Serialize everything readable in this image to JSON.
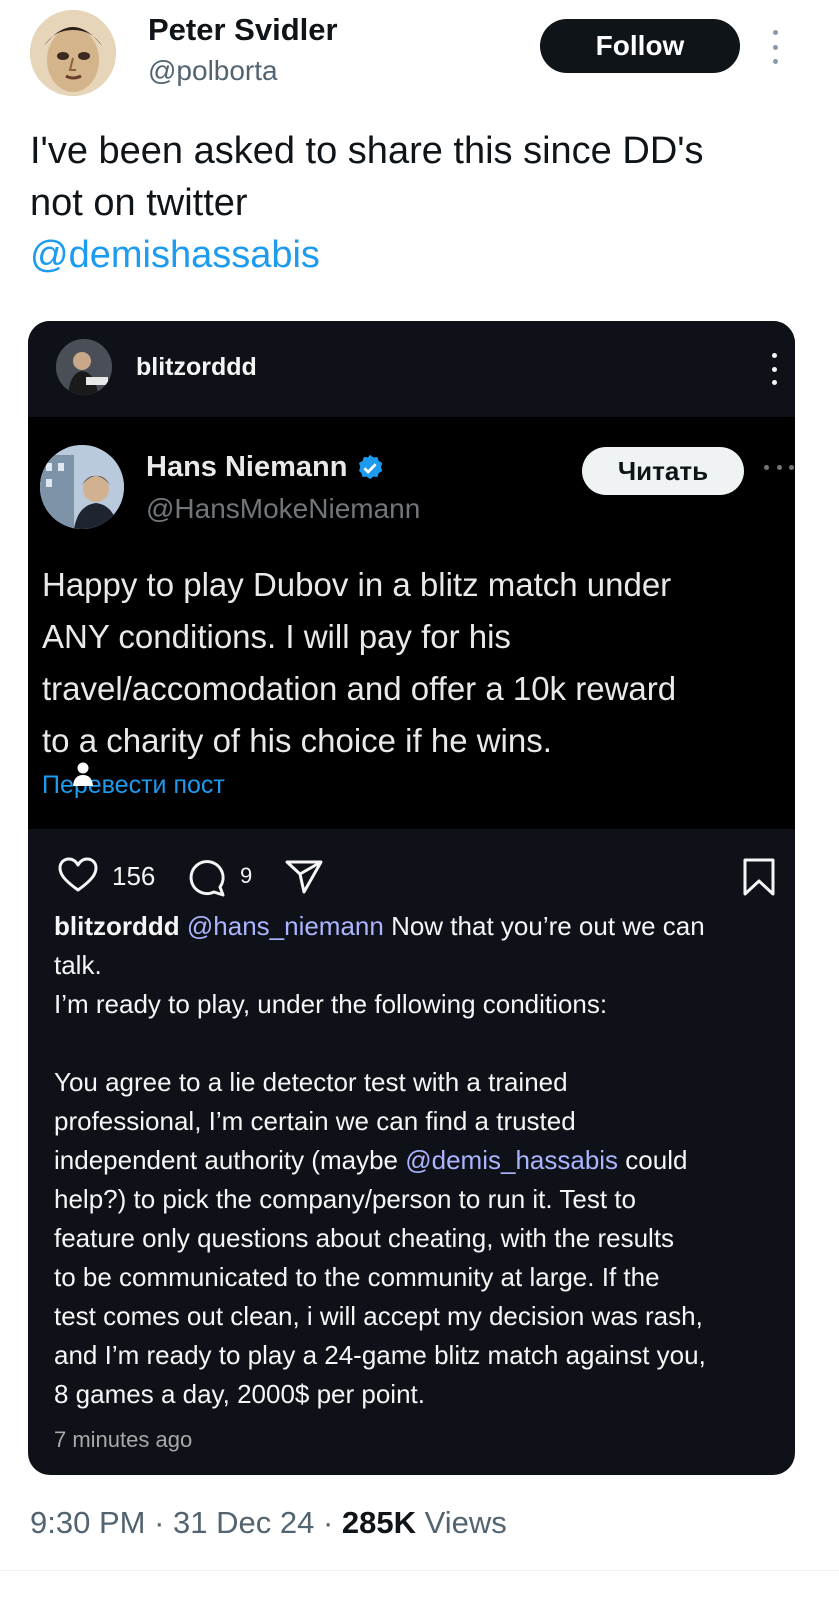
{
  "tweet": {
    "author_name": "Peter Svidler",
    "author_handle": "@polborta",
    "follow_label": "Follow",
    "text_lines": [
      "I've been asked to share this since DD's",
      "not on twitter"
    ],
    "mention": "@demishassabis",
    "time": "9:30 PM",
    "date": "31 Dec 24",
    "separator": " · ",
    "views_count": "285K",
    "views_label": "Views"
  },
  "card": {
    "username": "blitzorddd",
    "embedded": {
      "name": "Hans Niemann",
      "handle": "@HansMokeNiemann",
      "read_label": "Читать",
      "text_lines": [
        "Happy to play Dubov in a blitz match under",
        "ANY conditions. I will pay for his",
        "travel/accomodation and offer a 10k reward",
        "to a charity of his choice if he wins."
      ],
      "translate_label": "Перевести пост"
    },
    "likes": "156",
    "comments": "9",
    "caption": {
      "user": "blitzorddd",
      "tag": "@hans_niemann",
      "line1_rest": " Now that you’re out we can",
      "line2": "talk.",
      "line3": "I’m ready to play, under the following conditions:",
      "line4": "You agree to a lie detector test with a trained",
      "line5": "professional, I’m certain we can find a trusted",
      "line6a": "independent authority (maybe ",
      "line6_tag": "@demis_hassabis",
      "line6b": " could",
      "line7": "help?) to pick the company/person to run it. Test to",
      "line8": "feature only questions about cheating,  with the results",
      "line9": "to be communicated  to the community at large. If the",
      "line10": "test comes out clean, i will accept my decision was rash,",
      "line11": "and I’m ready to play a 24-game blitz match against you,",
      "line12": "8 games a day, 2000$ per point."
    },
    "time_ago": "7 minutes ago"
  },
  "colors": {
    "link_blue": "#1d9bf0",
    "card_bg": "#0e1117",
    "inner_bg": "#000000"
  },
  "icons": [
    "more-vert-icon",
    "verified-badge-icon",
    "heart-icon",
    "comment-icon",
    "share-icon",
    "bookmark-icon"
  ]
}
